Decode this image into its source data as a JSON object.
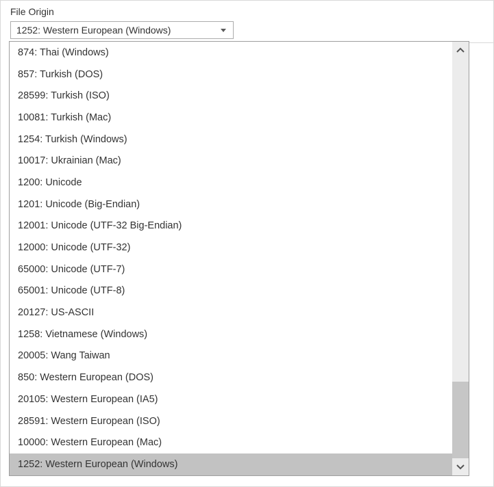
{
  "field": {
    "label": "File Origin",
    "selected": "1252: Western European (Windows)"
  },
  "options": [
    "874: Thai (Windows)",
    "857: Turkish (DOS)",
    "28599: Turkish (ISO)",
    "10081: Turkish (Mac)",
    "1254: Turkish (Windows)",
    "10017: Ukrainian (Mac)",
    "1200: Unicode",
    "1201: Unicode (Big-Endian)",
    "12001: Unicode (UTF-32 Big-Endian)",
    "12000: Unicode (UTF-32)",
    "65000: Unicode (UTF-7)",
    "65001: Unicode (UTF-8)",
    "20127: US-ASCII",
    "1258: Vietnamese (Windows)",
    "20005: Wang Taiwan",
    "850: Western European (DOS)",
    "20105: Western European (IA5)",
    "28591: Western European (ISO)",
    "10000: Western European (Mac)",
    "1252: Western European (Windows)"
  ],
  "selectedIndex": 19,
  "scroll": {
    "thumbTop": 471,
    "thumbHeight": 112
  }
}
